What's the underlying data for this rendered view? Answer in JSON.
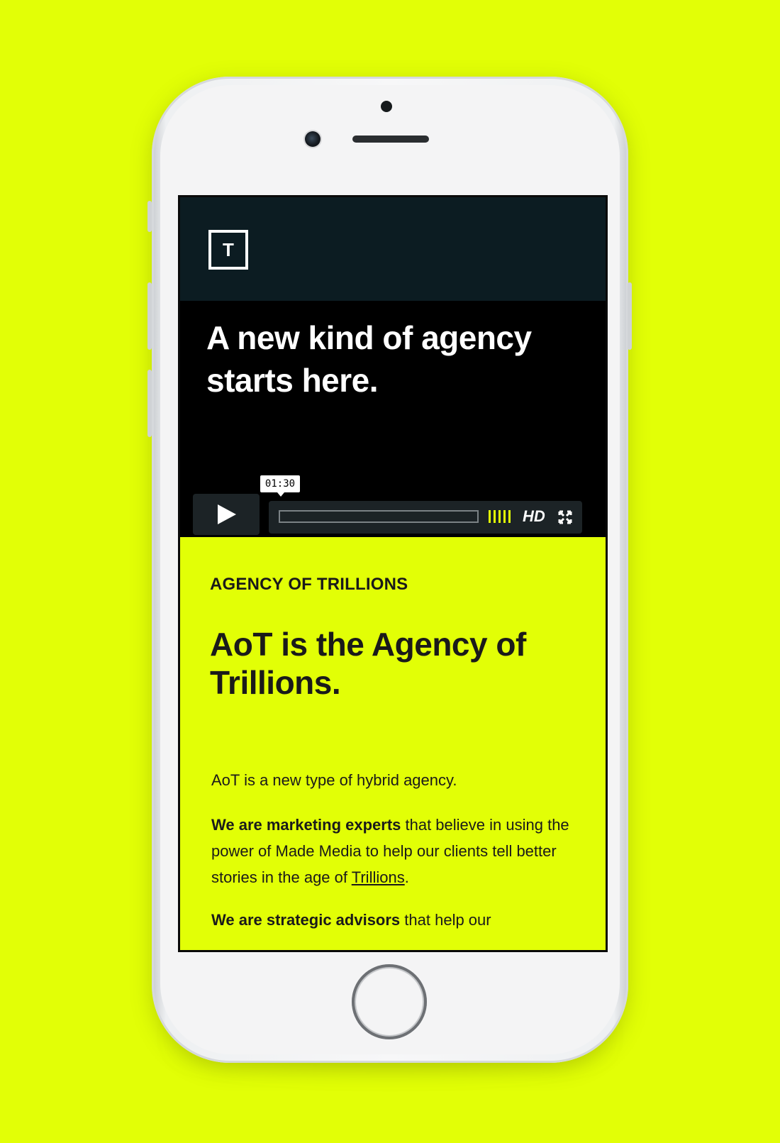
{
  "colors": {
    "background": "#e2ff06",
    "header": "#0c1c22",
    "hero": "#000000",
    "accent": "#e2ff06"
  },
  "logo": {
    "letter": "T"
  },
  "hero": {
    "title": "A new kind of agency starts here."
  },
  "video": {
    "time": "01:30",
    "hd_label": "HD",
    "play_icon": "play-icon",
    "fullscreen_icon": "fullscreen-icon"
  },
  "content": {
    "eyebrow": "AGENCY OF TRILLIONS",
    "headline": "AoT is the Agency of Trillions.",
    "p1": "AoT is a new type of hybrid agency.",
    "p2_bold": "We are marketing experts",
    "p2_rest": " that believe in using the power of Made Media to help our clients tell better stories in the age of ",
    "p2_link": "Trillions",
    "p2_end": ".",
    "p3_bold": "We are strategic advisors",
    "p3_rest": " that help our"
  }
}
